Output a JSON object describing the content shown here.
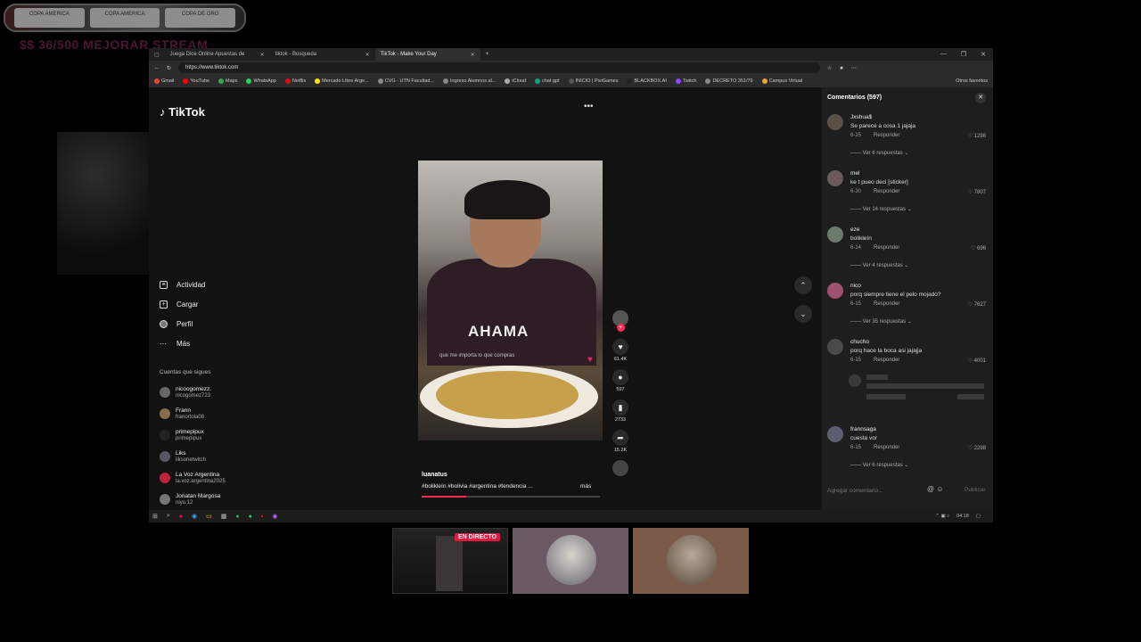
{
  "overlay": {
    "banner_items": [
      "COPA AMERICA",
      "COPA AMERICA",
      "COPA DE ORO"
    ],
    "goal_text": "$$ 36/500 MEJORAR STREAM"
  },
  "browser": {
    "tabs": [
      {
        "label": "Juega Dice Online Apuestas de",
        "active": false
      },
      {
        "label": "tiktok - Búsqueda",
        "active": false
      },
      {
        "label": "TikTok - Make Your Day",
        "active": true
      }
    ],
    "new_tab": "+",
    "url": "https://www.tiktok.com",
    "favorites": [
      "Gmail",
      "YouTube",
      "Maps",
      "WhatsApp",
      "Netflix",
      "Mercado Libre Arge...",
      "CVG - UTN Facultad...",
      "Ingreso Alumnos al...",
      "iCloud",
      "chat gpt",
      "INICIO | PiviGames",
      "BLACKBOX.AI",
      "Twitch",
      "DECRETO 351/79",
      "Campus Virtual"
    ],
    "other_favorites": "Otros favoritos"
  },
  "tiktok": {
    "logo": "TikTok",
    "menu": [
      {
        "label": "Actividad",
        "icon": "inbox-icon"
      },
      {
        "label": "Cargar",
        "icon": "upload-icon"
      },
      {
        "label": "Perfil",
        "icon": "profile-icon"
      },
      {
        "label": "Más",
        "icon": "more-icon"
      }
    ],
    "following_title": "Cuentas que sigues",
    "following": [
      {
        "name": "nicoogomezz.",
        "handle": "nicogomez723"
      },
      {
        "name": "Frann",
        "handle": "franortola08"
      },
      {
        "name": "primepipux",
        "handle": "primepipux"
      },
      {
        "name": "Liks",
        "handle": "liksonetwitch"
      },
      {
        "name": "La Voz Argentina",
        "handle": "la.voz.argentina2025"
      },
      {
        "name": "Jonatan Margosa",
        "handle": "niyo.12"
      }
    ],
    "video": {
      "author": "luanatus",
      "tags": "#bolikleín #bolivia #argentina #tendencia ...",
      "more": "más",
      "shirt_text": "AHAMA",
      "overlay_comment": "que me importa lo que compras",
      "progress": 0.25
    },
    "actions": [
      {
        "icon": "heart-icon",
        "count": "61.4K"
      },
      {
        "icon": "comment-icon",
        "count": "597"
      },
      {
        "icon": "bookmark-icon",
        "count": "2733"
      },
      {
        "icon": "share-icon",
        "count": "15.2K"
      }
    ]
  },
  "comments": {
    "title": "Comentarios (597)",
    "reply_label": "Responder",
    "items": [
      {
        "user": "Jxshua$",
        "text": "Se parece a cosa 1 jajaja",
        "date": "6-15",
        "likes": "1298",
        "replies": "Ver 6 respuestas"
      },
      {
        "user": "mel",
        "text": "ke t pueo deci [sticker]",
        "date": "6-30",
        "likes": "7807",
        "replies": "Ver 14 respuestas"
      },
      {
        "user": "eze",
        "text": "bolikleín",
        "date": "6-14",
        "likes": "696",
        "replies": "Ver 4 respuestas"
      },
      {
        "user": "nico",
        "text": "porq siempre tiene el pelo mojado?",
        "date": "6-15",
        "likes": "7627",
        "replies": "Ver 35 respuestas"
      },
      {
        "user": "chucho",
        "text": "porq hace la boca asi jajajja",
        "date": "6-15",
        "likes": "4001",
        "replies": ""
      },
      {
        "user": "frannsaga",
        "text": "cuesta vor",
        "date": "6-15",
        "likes": "2298",
        "replies": "Ver 6 respuestas"
      }
    ],
    "input_placeholder": "Agregar comentario...",
    "post_label": "Publicar"
  },
  "taskbar": {
    "time": "04:18"
  },
  "bottom": {
    "live_badge": "EN DIRECTO"
  }
}
